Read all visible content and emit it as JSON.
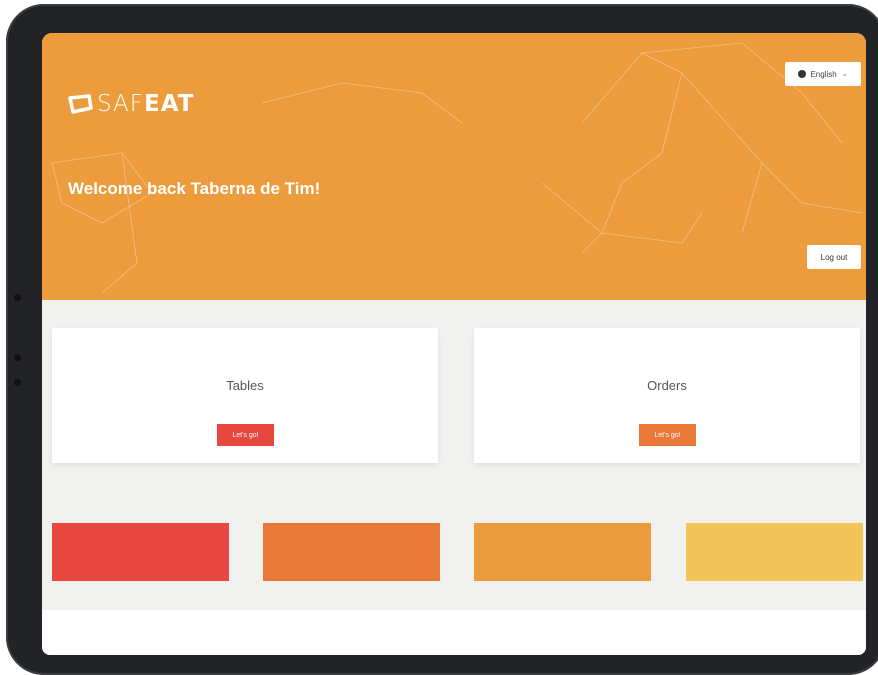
{
  "brand": {
    "logo_light": "SAF",
    "logo_bold": "EAT",
    "color_primary": "#ec9c3d"
  },
  "header": {
    "language_label": "English",
    "language_icon": "globe-icon",
    "welcome_text": "Welcome back Taberna de Tim!",
    "logout_label": "Log out"
  },
  "cards": [
    {
      "title": "Tables",
      "button_label": "Let's go!",
      "button_color": "#e8473f"
    },
    {
      "title": "Orders",
      "button_label": "Let's go!",
      "button_color": "#e87837"
    }
  ],
  "swatches": [
    {
      "color": "#e8473f"
    },
    {
      "color": "#e87837"
    },
    {
      "color": "#ec9c3d"
    },
    {
      "color": "#f2c45a"
    }
  ]
}
